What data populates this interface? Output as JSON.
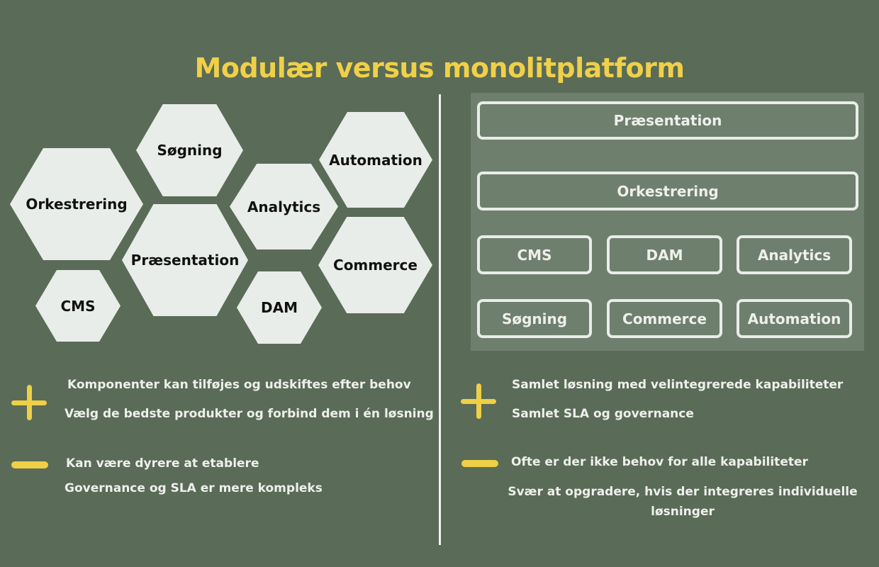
{
  "title": "Modulær versus monolitplatform",
  "colors": {
    "background": "#5a6b58",
    "accent": "#efcf45",
    "panel": "#6f7f6d",
    "hex_fill": "#e9ede9"
  },
  "modular": {
    "hexagons": [
      "Søgning",
      "Automation",
      "Orkestrering",
      "Analytics",
      "Præsentation",
      "Commerce",
      "CMS",
      "DAM"
    ],
    "pros_icon": "plus-icon",
    "pros": [
      "Komponenter kan tilføjes og udskiftes efter behov",
      "Vælg de bedste produkter og forbind dem i én løsning"
    ],
    "cons_icon": "minus-icon",
    "cons": [
      "Kan være dyrere at etablere",
      "Governance og SLA er mere kompleks"
    ]
  },
  "monolith": {
    "layers": [
      "Præsentation",
      "Orkestrering"
    ],
    "modules": [
      "CMS",
      "DAM",
      "Analytics",
      "Søgning",
      "Commerce",
      "Automation"
    ],
    "pros_icon": "plus-icon",
    "pros": [
      "Samlet løsning med velintegrerede kapabiliteter",
      "Samlet SLA og governance"
    ],
    "cons_icon": "minus-icon",
    "cons": [
      "Ofte er der ikke behov for alle kapabiliteter",
      "Svær at opgradere, hvis der integreres individuelle løsninger"
    ]
  }
}
